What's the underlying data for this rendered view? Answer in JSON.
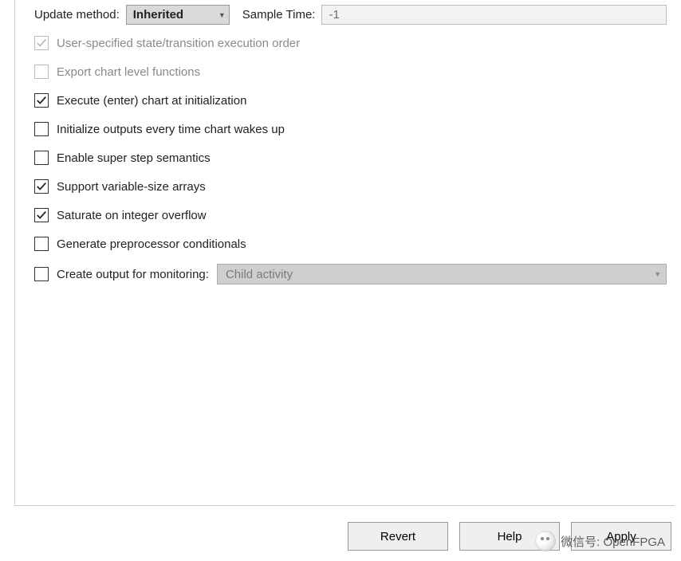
{
  "top": {
    "update_method_label": "Update method:",
    "update_method_value": "Inherited",
    "sample_time_label": "Sample Time:",
    "sample_time_value": "-1"
  },
  "checks": [
    {
      "label": "User-specified state/transition execution order",
      "checked": true,
      "disabled": true
    },
    {
      "label": "Export chart level functions",
      "checked": false,
      "disabled": true
    },
    {
      "label": "Execute (enter) chart at initialization",
      "checked": true,
      "disabled": false
    },
    {
      "label": "Initialize outputs every time chart wakes up",
      "checked": false,
      "disabled": false
    },
    {
      "label": "Enable super step semantics",
      "checked": false,
      "disabled": false
    },
    {
      "label": "Support variable-size arrays",
      "checked": true,
      "disabled": false
    },
    {
      "label": "Saturate on integer overflow",
      "checked": true,
      "disabled": false
    },
    {
      "label": "Generate preprocessor conditionals",
      "checked": false,
      "disabled": false
    }
  ],
  "monitor": {
    "checkbox_checked": false,
    "label": "Create output for monitoring:",
    "dropdown_value": "Child activity",
    "dropdown_disabled": true
  },
  "buttons": {
    "revert": "Revert",
    "help": "Help",
    "apply": "Apply"
  },
  "watermark_text": "微信号: OpenFPGA"
}
